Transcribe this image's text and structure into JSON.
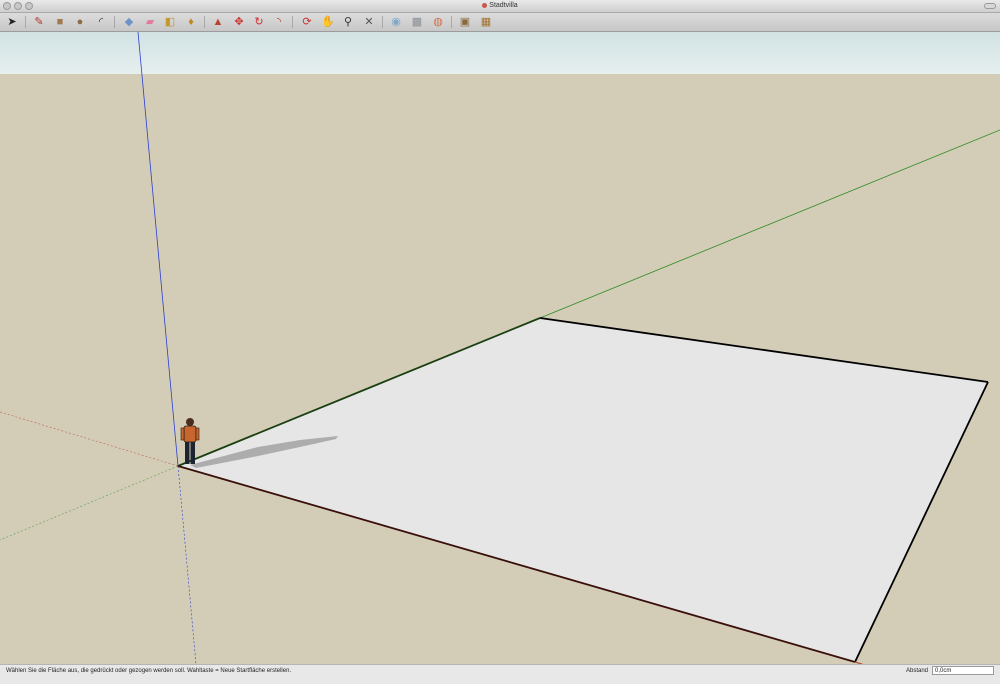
{
  "window": {
    "title": "Stadtvilla"
  },
  "toolbar": {
    "tools": [
      {
        "name": "select-tool",
        "glyph": "➤",
        "color": "#222222"
      },
      {
        "name": "pencil-tool",
        "glyph": "✎",
        "color": "#b5332d"
      },
      {
        "name": "rectangle-tool",
        "glyph": "■",
        "color": "#a17b4f"
      },
      {
        "name": "circle-tool",
        "glyph": "●",
        "color": "#8e6b44"
      },
      {
        "name": "arc-tool",
        "glyph": "◜",
        "color": "#333333"
      },
      {
        "name": "make-component-tool",
        "glyph": "◆",
        "color": "#6c94c9"
      },
      {
        "name": "eraser-tool",
        "glyph": "▰",
        "color": "#e27b9a"
      },
      {
        "name": "tape-measure-tool",
        "glyph": "◧",
        "color": "#c39a2b"
      },
      {
        "name": "paint-bucket-tool",
        "glyph": "♦",
        "color": "#c1861d"
      },
      {
        "name": "push-pull-tool",
        "glyph": "▲",
        "color": "#b5452b"
      },
      {
        "name": "move-tool",
        "glyph": "✥",
        "color": "#cc2f2f"
      },
      {
        "name": "rotate-tool",
        "glyph": "↻",
        "color": "#cc2f2f"
      },
      {
        "name": "offset-tool",
        "glyph": "◝",
        "color": "#c0392b"
      },
      {
        "name": "orbit-tool",
        "glyph": "⟳",
        "color": "#cc2f2f"
      },
      {
        "name": "pan-tool",
        "glyph": "✋",
        "color": "#444444"
      },
      {
        "name": "zoom-tool",
        "glyph": "⚲",
        "color": "#333333"
      },
      {
        "name": "zoom-extents-tool",
        "glyph": "✕",
        "color": "#555555"
      },
      {
        "name": "get-models-tool",
        "glyph": "◉",
        "color": "#7fa8c9"
      },
      {
        "name": "share-model-tool",
        "glyph": "▩",
        "color": "#8a8f96"
      },
      {
        "name": "google-earth-tool",
        "glyph": "◍",
        "color": "#d0704a"
      },
      {
        "name": "warehouse-tool",
        "glyph": "▣",
        "color": "#8a6a3d"
      },
      {
        "name": "extension-warehouse-tool",
        "glyph": "▦",
        "color": "#a0702f"
      }
    ]
  },
  "status": {
    "message": "Wählen Sie die Fläche aus, die gedrückt oder gezogen werden soll. Wahltaste = Neue Startfläche erstellen.",
    "measure_label": "Abstand",
    "measure_value": "0,0cm"
  },
  "colors": {
    "sky": "#dbe8e9",
    "ground": "#d3cdb7",
    "face": "#e6e6e6",
    "edge": "#000000",
    "axis_red": "#b43a24",
    "axis_green": "#2f8a23",
    "axis_blue": "#2a3fd0"
  }
}
